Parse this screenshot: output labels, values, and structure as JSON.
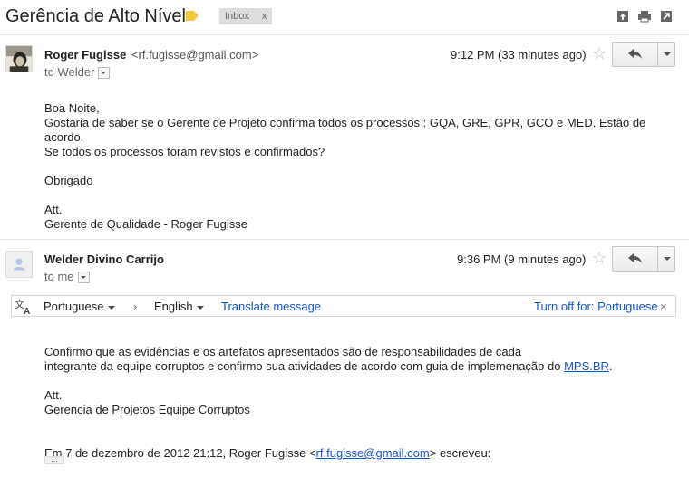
{
  "header": {
    "subject": "Gerência de Alto Nível",
    "label_chip": "Inbox",
    "label_close": "x",
    "icons": [
      "new-window-icon",
      "print-icon",
      "expand-icon"
    ]
  },
  "messages": [
    {
      "sender_name": "Roger Fugisse",
      "sender_email": "<rf.fugisse@gmail.com>",
      "to_line": "to Welder",
      "time": "9:12 PM (33 minutes ago)",
      "body_lines": [
        "Boa Noite,",
        "Gostaria de saber se o Gerente de Projeto confirma todos os processos : GQA, GRE, GPR, GCO e MED. Estão de",
        "acordo.",
        "Se todos os processos foram revistos e confirmados?",
        "",
        "Obrigado",
        "",
        "Att.",
        "Gerente de Qualidade - Roger Fugisse"
      ]
    },
    {
      "sender_name": "Welder Divino Carrijo",
      "to_line": "to me",
      "time": "9:36 PM (9 minutes ago)",
      "translate": {
        "from_lang": "Portuguese",
        "arrow": "›",
        "to_lang": "English",
        "translate_link": "Translate message",
        "turn_off": "Turn off for: Portuguese",
        "close": "×"
      },
      "body_line1": "Confirmo que as evidências e os artefatos apresentados são de responsabilidades de cada",
      "body_line2_prefix": "integrante da equipe corruptos e confirmo sua atividades de acordo com guia de implemenação do ",
      "body_line2_link": "MPS.BR",
      "body_line2_suffix": ".",
      "signature_1": "Att.",
      "signature_2": "Gerencia de Projetos Equipe Corruptos",
      "quote_prefix": "Em 7 de dezembro de 2012 21:12, Roger Fugisse <",
      "quote_email": "rf.fugisse@gmail.com",
      "quote_suffix": "> escreveu:",
      "ellipsis": "..."
    }
  ]
}
